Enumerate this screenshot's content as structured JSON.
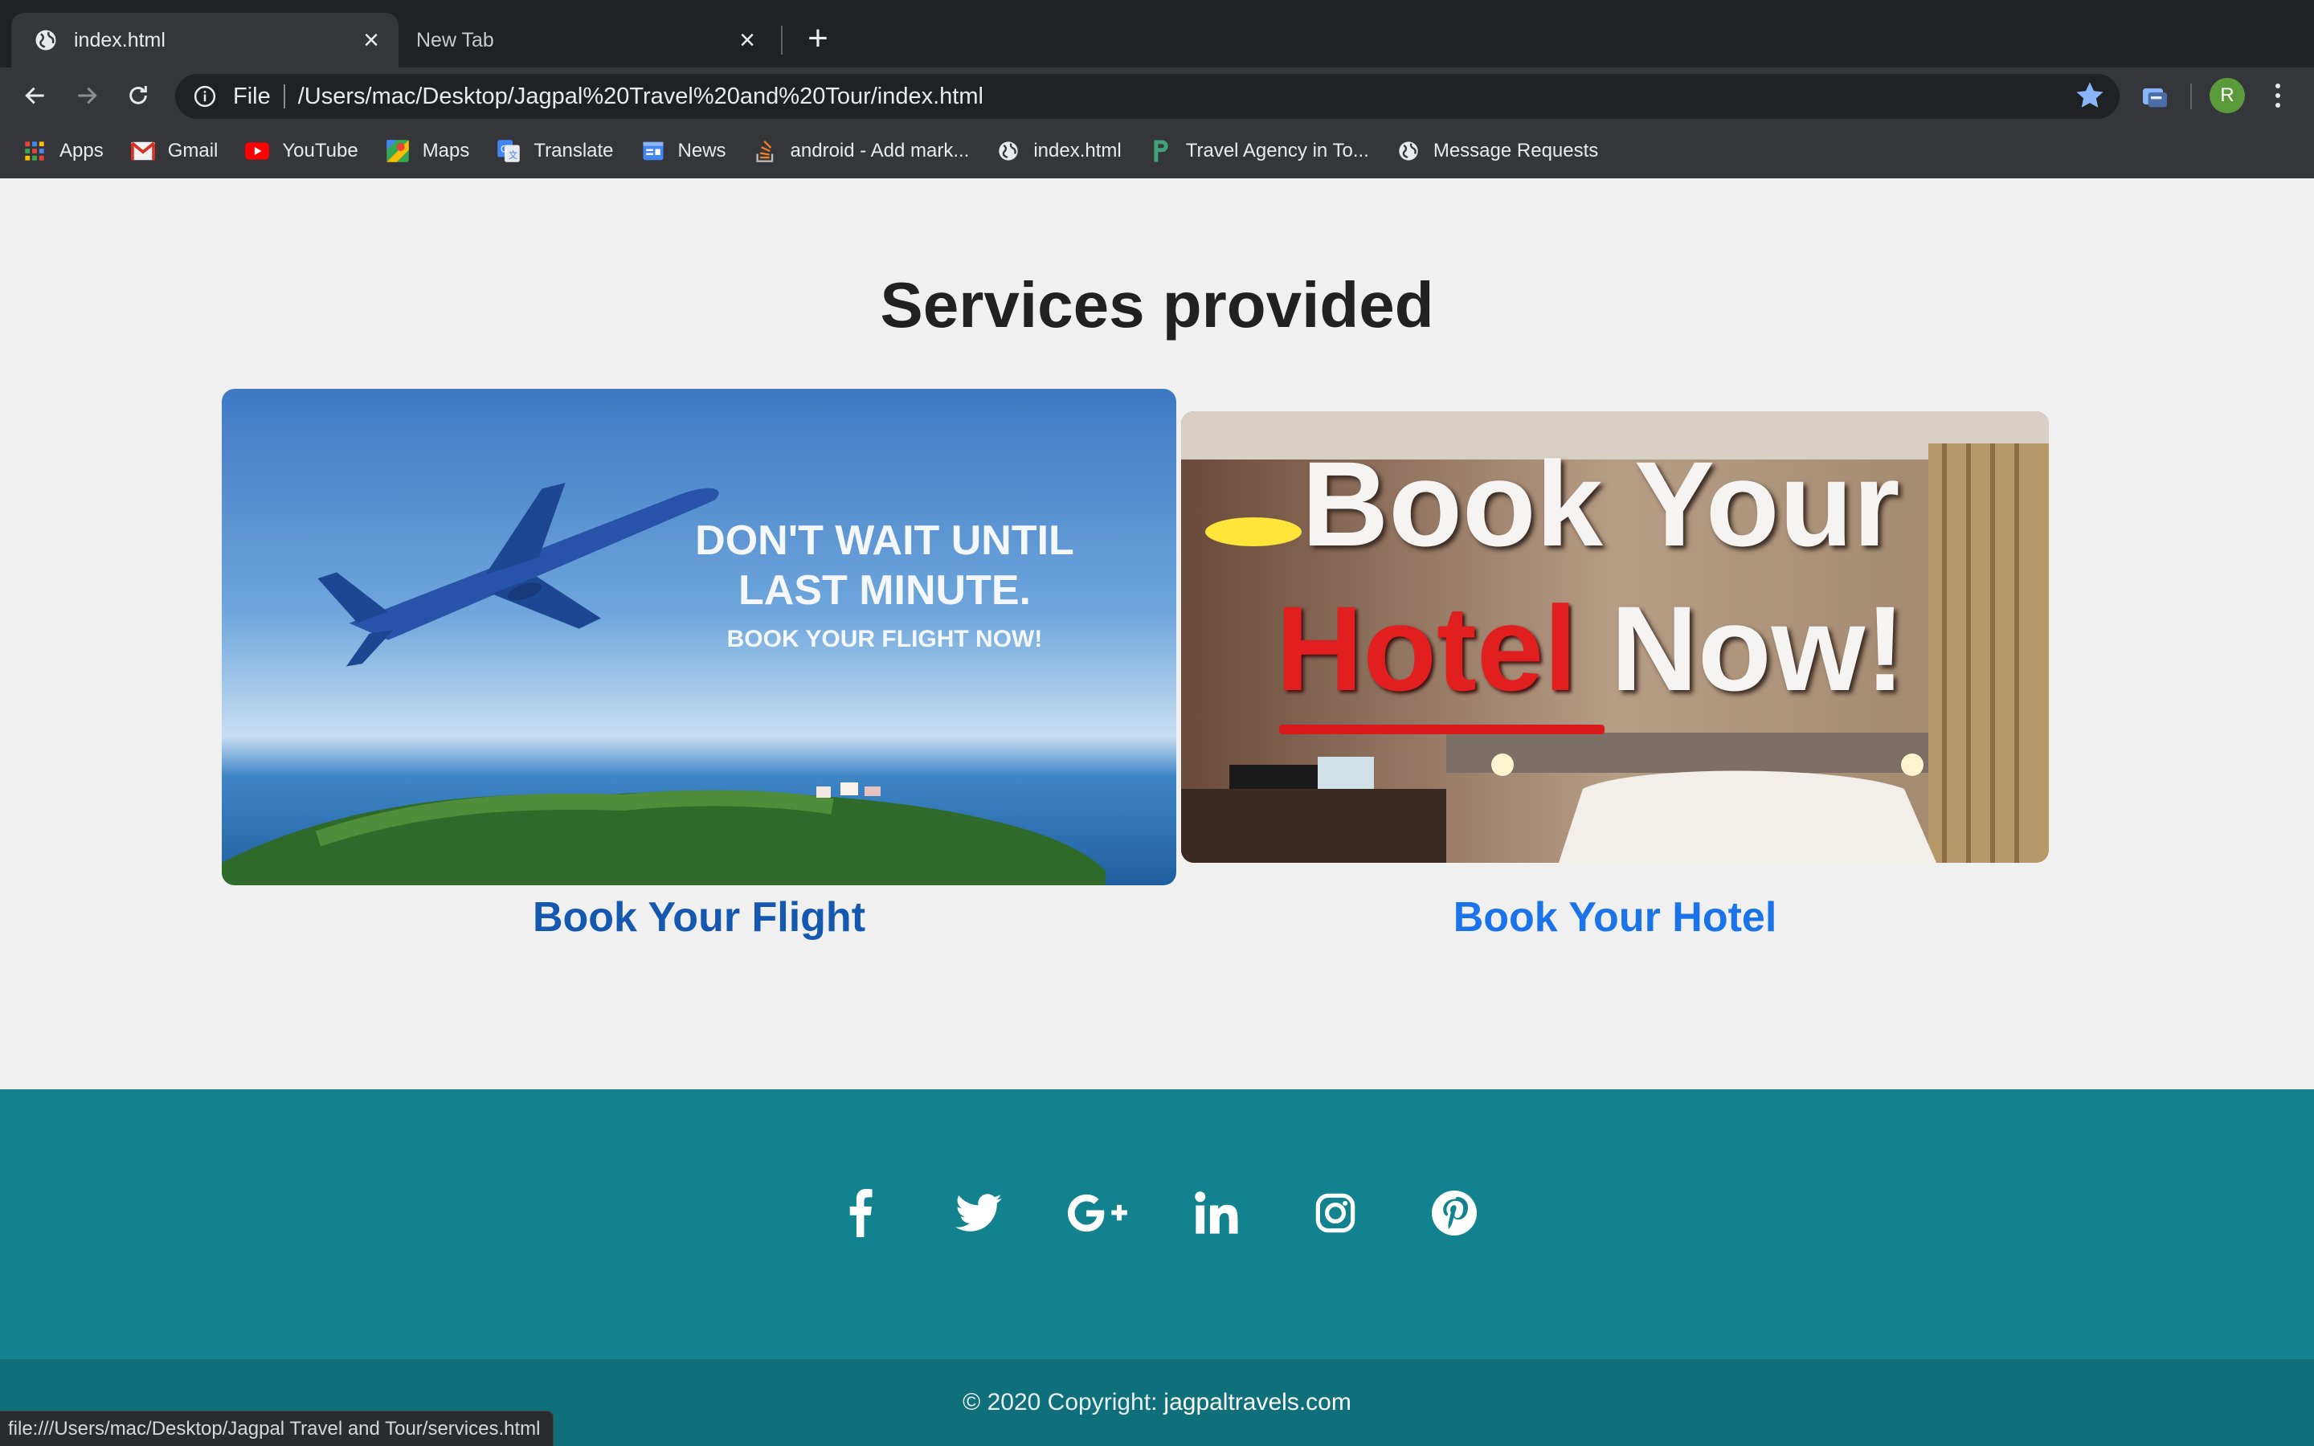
{
  "browser": {
    "tabs": [
      {
        "label": "index.html",
        "active": true
      },
      {
        "label": "New Tab",
        "active": false
      }
    ],
    "new_tab_label": "+",
    "omnibox": {
      "scheme": "File",
      "url": "/Users/mac/Desktop/Jagpal%20Travel%20and%20Tour/index.html"
    },
    "profile_initial": "R",
    "bookmarks": [
      {
        "label": "Apps",
        "icon": "apps-grid-icon"
      },
      {
        "label": "Gmail",
        "icon": "gmail-icon"
      },
      {
        "label": "YouTube",
        "icon": "youtube-icon"
      },
      {
        "label": "Maps",
        "icon": "maps-icon"
      },
      {
        "label": "Translate",
        "icon": "translate-icon"
      },
      {
        "label": "News",
        "icon": "news-icon"
      },
      {
        "label": "android - Add mark...",
        "icon": "stackoverflow-icon"
      },
      {
        "label": "index.html",
        "icon": "globe-icon"
      },
      {
        "label": "Travel Agency in To...",
        "icon": "p-logo-icon"
      },
      {
        "label": "Message Requests",
        "icon": "globe-icon"
      }
    ]
  },
  "page": {
    "title": "Services provided",
    "cards": [
      {
        "image_text": {
          "line1": "DON'T WAIT UNTIL",
          "line2": "LAST MINUTE.",
          "line3": "BOOK YOUR FLIGHT NOW!"
        },
        "link": "Book Your Flight"
      },
      {
        "image_text": {
          "line1": "Book Your",
          "word_red": "Hotel",
          "word_white": "Now!"
        },
        "link": "Book Your Hotel"
      }
    ],
    "social_icons": [
      "facebook-icon",
      "twitter-icon",
      "google-plus-icon",
      "linkedin-icon",
      "instagram-icon",
      "pinterest-icon"
    ],
    "footer": {
      "copyright": "© 2020 Copyright:",
      "site": "jagpaltravels.com"
    }
  },
  "status_bar": "file:///Users/mac/Desktop/Jagpal Travel and Tour/services.html",
  "colors": {
    "tabstrip": "#202124",
    "toolbar": "#35363a",
    "footer": "#12828f",
    "copyright_bar": "#0f6f7b",
    "link": "#1a73e8"
  }
}
